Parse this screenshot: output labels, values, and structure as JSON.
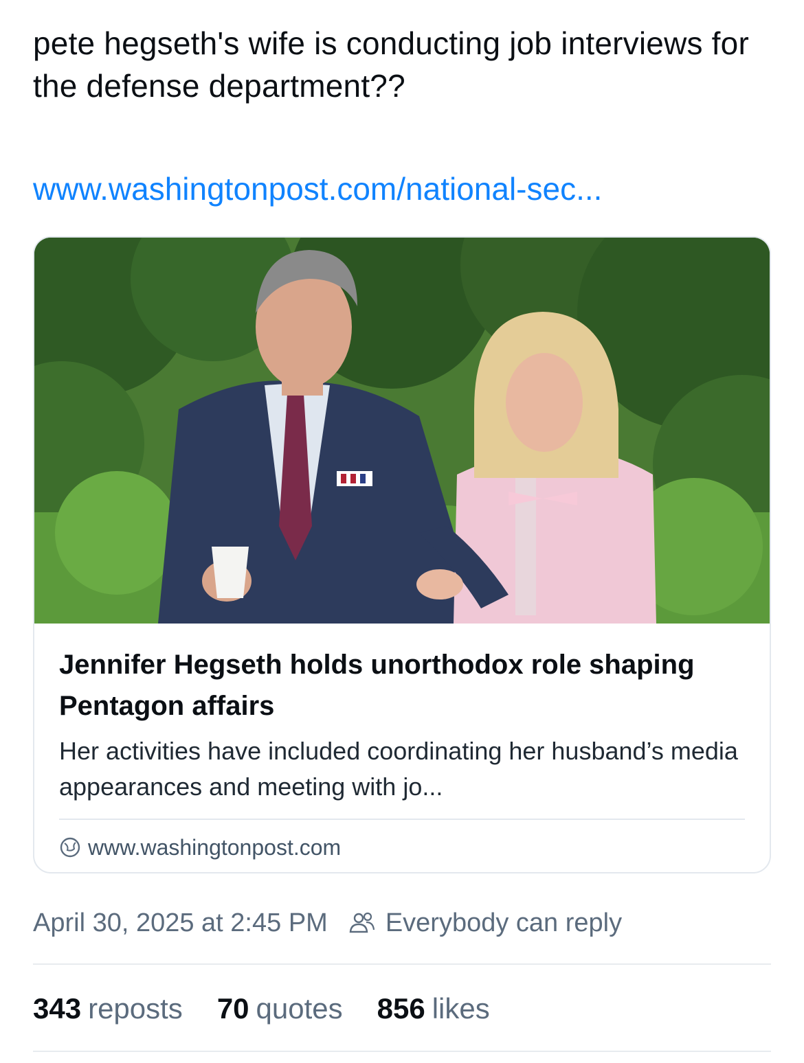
{
  "post": {
    "text": "pete hegseth's wife is conducting job interviews for the defense department??",
    "link_text": "www.washingtonpost.com/national-sec..."
  },
  "card": {
    "image_alt": "",
    "title": "Jennifer Hegseth holds unorthodox role shaping Pentagon affairs",
    "description": "Her activities have included coordinating her husband’s media appearances and meeting with jo...",
    "domain": "www.washingtonpost.com"
  },
  "meta": {
    "timestamp": "April 30, 2025 at 2:45 PM",
    "reply_setting": "Everybody can reply"
  },
  "stats": {
    "reposts_count": "343",
    "reposts_label": "reposts",
    "quotes_count": "70",
    "quotes_label": "quotes",
    "likes_count": "856",
    "likes_label": "likes"
  },
  "colors": {
    "link": "#1083fe",
    "text": "#0b0f14",
    "muted": "#5b6b7d",
    "border": "#e3e8ee"
  },
  "icons": {
    "domain_icon": "globe-icon",
    "reply_icon": "people-icon"
  }
}
